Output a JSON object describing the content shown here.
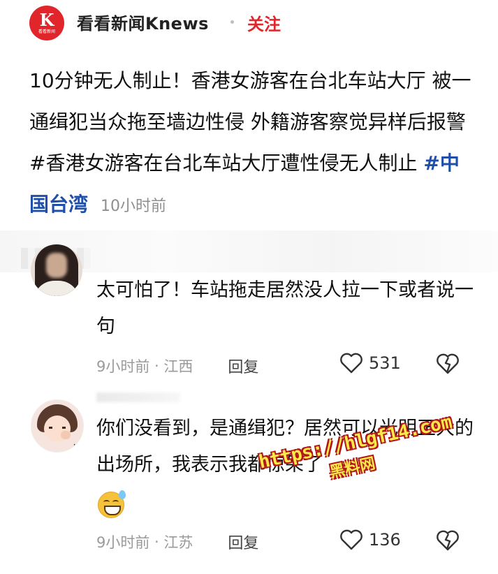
{
  "header": {
    "source_name": "看看新闻Knews",
    "follow_label": "关注",
    "logo_letter": "K",
    "logo_sub": "看看新闻"
  },
  "post": {
    "text": "10分钟无人制止！香港女游客在台北车站大厅 被一通缉犯当众拖至墙边性侵 外籍游客察觉异样后报警#香港女游客在台北车站大厅遭性侵无人制止 ",
    "topic": "#中国台湾",
    "time": "10小时前"
  },
  "comments": [
    {
      "text": "太可怕了！车站拖走居然没人拉一下或者说一句",
      "time": "9小时前",
      "location": "江西",
      "reply_label": "回复",
      "likes": "531"
    },
    {
      "text": "你们没看到，是通缉犯？居然可以光明正大的出场所，我表示我都惊呆了",
      "time": "9小时前",
      "location": "江苏",
      "reply_label": "回复",
      "likes": "136",
      "emoji": "grinning-sweat-emoji"
    }
  ],
  "watermark": {
    "url": "https://hlgf14.com",
    "brand": "黑料网"
  },
  "colors": {
    "accent": "#e0262b",
    "topic": "#1f4fa8",
    "meta": "#9a9a9a"
  },
  "icons": [
    "like-heart-icon",
    "dislike-broken-heart-icon"
  ]
}
